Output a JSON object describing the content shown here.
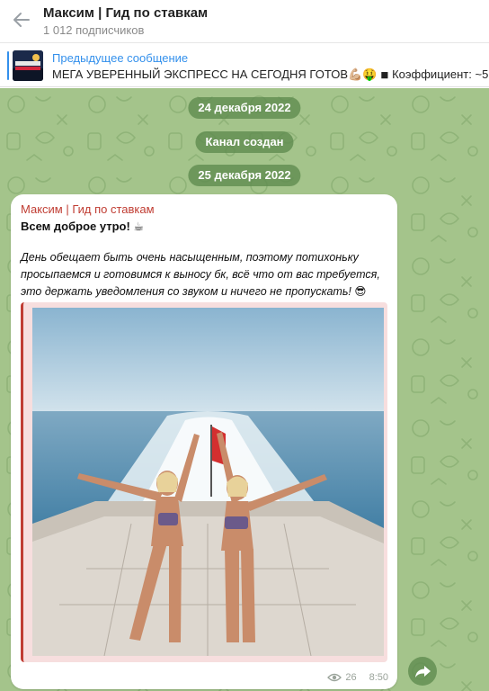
{
  "header": {
    "title": "Максим | Гид по ставкам",
    "subscribers": "1 012 подписчиков"
  },
  "pinned": {
    "label": "Предыдущее сообщение",
    "text": "МЕГА УВЕРЕННЫЙ ЭКСПРЕСС НА СЕГОДНЯ ГОТОВ💪🏼🤑  ◾ Коэффициент: ~5"
  },
  "service": {
    "date1": "24 декабря 2022",
    "created": "Канал создан",
    "date2": "25 декабря 2022"
  },
  "message": {
    "author": "Максим | Гид по ставкам",
    "greeting": "Всем доброе утро! ☕",
    "body": "День обещает быть очень насыщенным, поэтому потихоньку просыпаемся и готовимся к выносу бк, всё что от вас требуется, это держать уведомления со звуком и ничего не пропускать! 😎",
    "views": "26",
    "time": "8:50"
  },
  "colors": {
    "accent": "#3390ec",
    "author": "#c03d33",
    "chat_bg": "#a4c48b",
    "service_pill": "#5e8a4e"
  },
  "icons": [
    "back-arrow-icon",
    "eye-icon",
    "share-arrow-icon"
  ]
}
